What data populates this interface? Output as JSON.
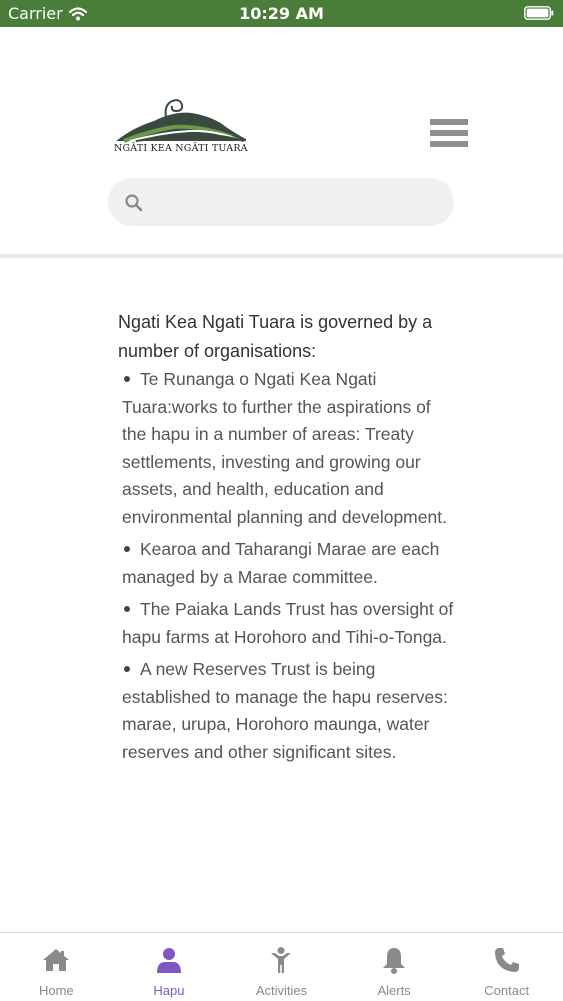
{
  "status_bar": {
    "carrier": "Carrier",
    "time": "10:29 AM",
    "background_color": "#4a7c3a"
  },
  "header": {
    "logo_text": "NGĀTI KEA NGĀTI TUARA",
    "search": {
      "placeholder": "",
      "value": ""
    }
  },
  "content": {
    "intro": "Ngati Kea Ngati Tuara is governed by a number of organisations:",
    "items": [
      "Te Runanga o Ngati Kea Ngati Tuara:works to further the aspirations of the hapu in a number of areas: Treaty settlements, investing and growing our assets, and health, education and environmental planning and development.",
      "Kearoa and Taharangi Marae are each managed by a Marae committee.",
      "The Paiaka Lands Trust has oversight of hapu farms at Horohoro and Tihi-o-Tonga.",
      "A new Reserves Trust is being established to manage the hapu reserves: marae, urupa, Horohoro maunga, water reserves and other significant sites."
    ]
  },
  "tabbar": {
    "tabs": [
      {
        "label": "Home",
        "icon": "home-icon",
        "active": false
      },
      {
        "label": "Hapu",
        "icon": "person-icon",
        "active": true
      },
      {
        "label": "Activities",
        "icon": "child-icon",
        "active": false
      },
      {
        "label": "Alerts",
        "icon": "bell-icon",
        "active": false
      },
      {
        "label": "Contact",
        "icon": "phone-icon",
        "active": false
      }
    ],
    "active_color": "#7e57c2",
    "inactive_color": "#8a8a8a"
  }
}
